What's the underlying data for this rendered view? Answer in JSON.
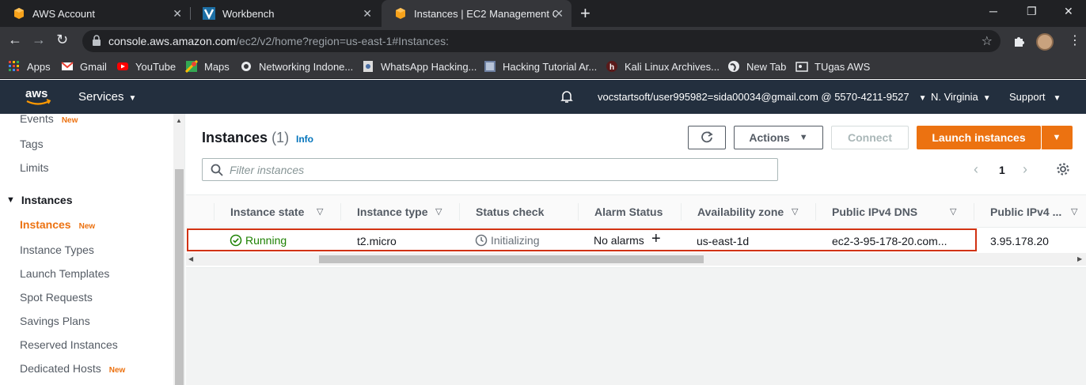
{
  "browser": {
    "tabs": [
      {
        "title": "AWS Account",
        "icon": "aws-box-icon"
      },
      {
        "title": "Workbench",
        "icon": "vocareum-icon"
      },
      {
        "title": "Instances | EC2 Management Co",
        "icon": "aws-box-icon",
        "active": true
      }
    ],
    "new_tab": "+",
    "url_host": "console.aws.amazon.com",
    "url_path": "/ec2/v2/home?region=us-east-1#Instances:",
    "bookmarks": [
      "Apps",
      "Gmail",
      "YouTube",
      "Maps",
      "Networking Indone...",
      "WhatsApp Hacking...",
      "Hacking Tutorial Ar...",
      "Kali Linux Archives...",
      "New Tab",
      "TUgas AWS"
    ]
  },
  "aws_header": {
    "services": "Services",
    "account": "vocstartsoft/user995982=sida00034@gmail.com @ 5570-4211-9527",
    "region": "N. Virginia",
    "support": "Support"
  },
  "sidebar": {
    "items_top": [
      {
        "label": "Events",
        "new": "New"
      },
      {
        "label": "Tags"
      },
      {
        "label": "Limits"
      }
    ],
    "section": "Instances",
    "items": [
      {
        "label": "Instances",
        "new": "New",
        "active": true
      },
      {
        "label": "Instance Types"
      },
      {
        "label": "Launch Templates"
      },
      {
        "label": "Spot Requests"
      },
      {
        "label": "Savings Plans"
      },
      {
        "label": "Reserved Instances"
      },
      {
        "label": "Dedicated Hosts",
        "new": "New"
      }
    ]
  },
  "main": {
    "title": "Instances",
    "count": "(1)",
    "info": "Info",
    "actions": "Actions",
    "connect": "Connect",
    "launch": "Launch instances",
    "filter_placeholder": "Filter instances",
    "page": "1",
    "columns": [
      "Instance state",
      "Instance type",
      "Status check",
      "Alarm Status",
      "Availability zone",
      "Public IPv4 DNS",
      "Public IPv4 ..."
    ],
    "row": {
      "state": "Running",
      "type": "t2.micro",
      "status": "Initializing",
      "alarm": "No alarms",
      "az": "us-east-1d",
      "dns": "ec2-3-95-178-20.com...",
      "ip": "3.95.178.20"
    }
  },
  "colors": {
    "aws_header": "#232f3e",
    "accent_orange": "#ec7211",
    "running_green": "#1d8102",
    "highlight_red": "#d13212",
    "link_blue": "#0073bb"
  }
}
